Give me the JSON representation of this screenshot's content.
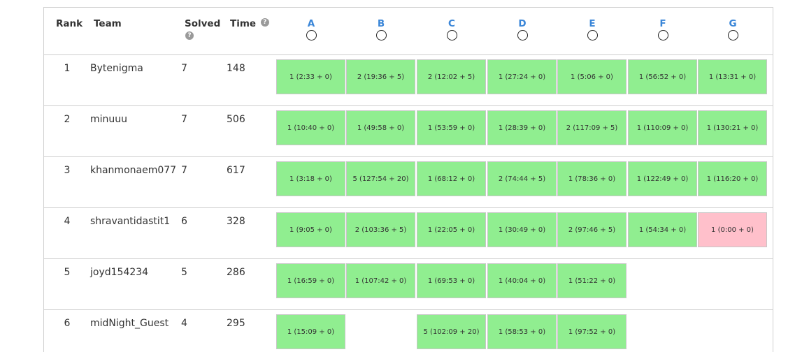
{
  "header": {
    "rank": "Rank",
    "team": "Team",
    "solved": "Solved",
    "time": "Time",
    "help_icon_glyph": "?",
    "problems": [
      "A",
      "B",
      "C",
      "D",
      "E",
      "F",
      "G"
    ]
  },
  "colors": {
    "solved": "#90ee90",
    "attempted": "#ffc0cb",
    "problem_link": "#3a86d8"
  },
  "rows": [
    {
      "rank": "1",
      "team": "Bytenigma",
      "solved": "7",
      "time": "148",
      "scores": [
        {
          "text": "1 (2:33 + 0)",
          "status": "ok"
        },
        {
          "text": "2 (19:36 + 5)",
          "status": "ok"
        },
        {
          "text": "2 (12:02 + 5)",
          "status": "ok"
        },
        {
          "text": "1 (27:24 + 0)",
          "status": "ok"
        },
        {
          "text": "1 (5:06 + 0)",
          "status": "ok"
        },
        {
          "text": "1 (56:52 + 0)",
          "status": "ok"
        },
        {
          "text": "1 (13:31 + 0)",
          "status": "ok"
        }
      ]
    },
    {
      "rank": "2",
      "team": "minuuu",
      "solved": "7",
      "time": "506",
      "scores": [
        {
          "text": "1 (10:40 + 0)",
          "status": "ok"
        },
        {
          "text": "1 (49:58 + 0)",
          "status": "ok"
        },
        {
          "text": "1 (53:59 + 0)",
          "status": "ok"
        },
        {
          "text": "1 (28:39 + 0)",
          "status": "ok"
        },
        {
          "text": "2 (117:09 + 5)",
          "status": "ok"
        },
        {
          "text": "1 (110:09 + 0)",
          "status": "ok"
        },
        {
          "text": "1 (130:21 + 0)",
          "status": "ok"
        }
      ]
    },
    {
      "rank": "3",
      "team": "khanmonaem077",
      "solved": "7",
      "time": "617",
      "scores": [
        {
          "text": "1 (3:18 + 0)",
          "status": "ok"
        },
        {
          "text": "5 (127:54 + 20)",
          "status": "ok"
        },
        {
          "text": "1 (68:12 + 0)",
          "status": "ok"
        },
        {
          "text": "2 (74:44 + 5)",
          "status": "ok"
        },
        {
          "text": "1 (78:36 + 0)",
          "status": "ok"
        },
        {
          "text": "1 (122:49 + 0)",
          "status": "ok"
        },
        {
          "text": "1 (116:20 + 0)",
          "status": "ok"
        }
      ]
    },
    {
      "rank": "4",
      "team": "shravantidastit1",
      "solved": "6",
      "time": "328",
      "scores": [
        {
          "text": "1 (9:05 + 0)",
          "status": "ok"
        },
        {
          "text": "2 (103:36 + 5)",
          "status": "ok"
        },
        {
          "text": "1 (22:05 + 0)",
          "status": "ok"
        },
        {
          "text": "1 (30:49 + 0)",
          "status": "ok"
        },
        {
          "text": "2 (97:46 + 5)",
          "status": "ok"
        },
        {
          "text": "1 (54:34 + 0)",
          "status": "ok"
        },
        {
          "text": "1 (0:00 + 0)",
          "status": "bad"
        }
      ]
    },
    {
      "rank": "5",
      "team": "joyd154234",
      "solved": "5",
      "time": "286",
      "scores": [
        {
          "text": "1 (16:59 + 0)",
          "status": "ok"
        },
        {
          "text": "1 (107:42 + 0)",
          "status": "ok"
        },
        {
          "text": "1 (69:53 + 0)",
          "status": "ok"
        },
        {
          "text": "1 (40:04 + 0)",
          "status": "ok"
        },
        {
          "text": "1 (51:22 + 0)",
          "status": "ok"
        },
        null,
        null
      ]
    },
    {
      "rank": "6",
      "team": "midNight_Guest",
      "solved": "4",
      "time": "295",
      "scores": [
        {
          "text": "1 (15:09 + 0)",
          "status": "ok"
        },
        null,
        {
          "text": "5 (102:09 + 20)",
          "status": "ok"
        },
        {
          "text": "1 (58:53 + 0)",
          "status": "ok"
        },
        {
          "text": "1 (97:52 + 0)",
          "status": "ok"
        },
        null,
        null
      ]
    }
  ]
}
